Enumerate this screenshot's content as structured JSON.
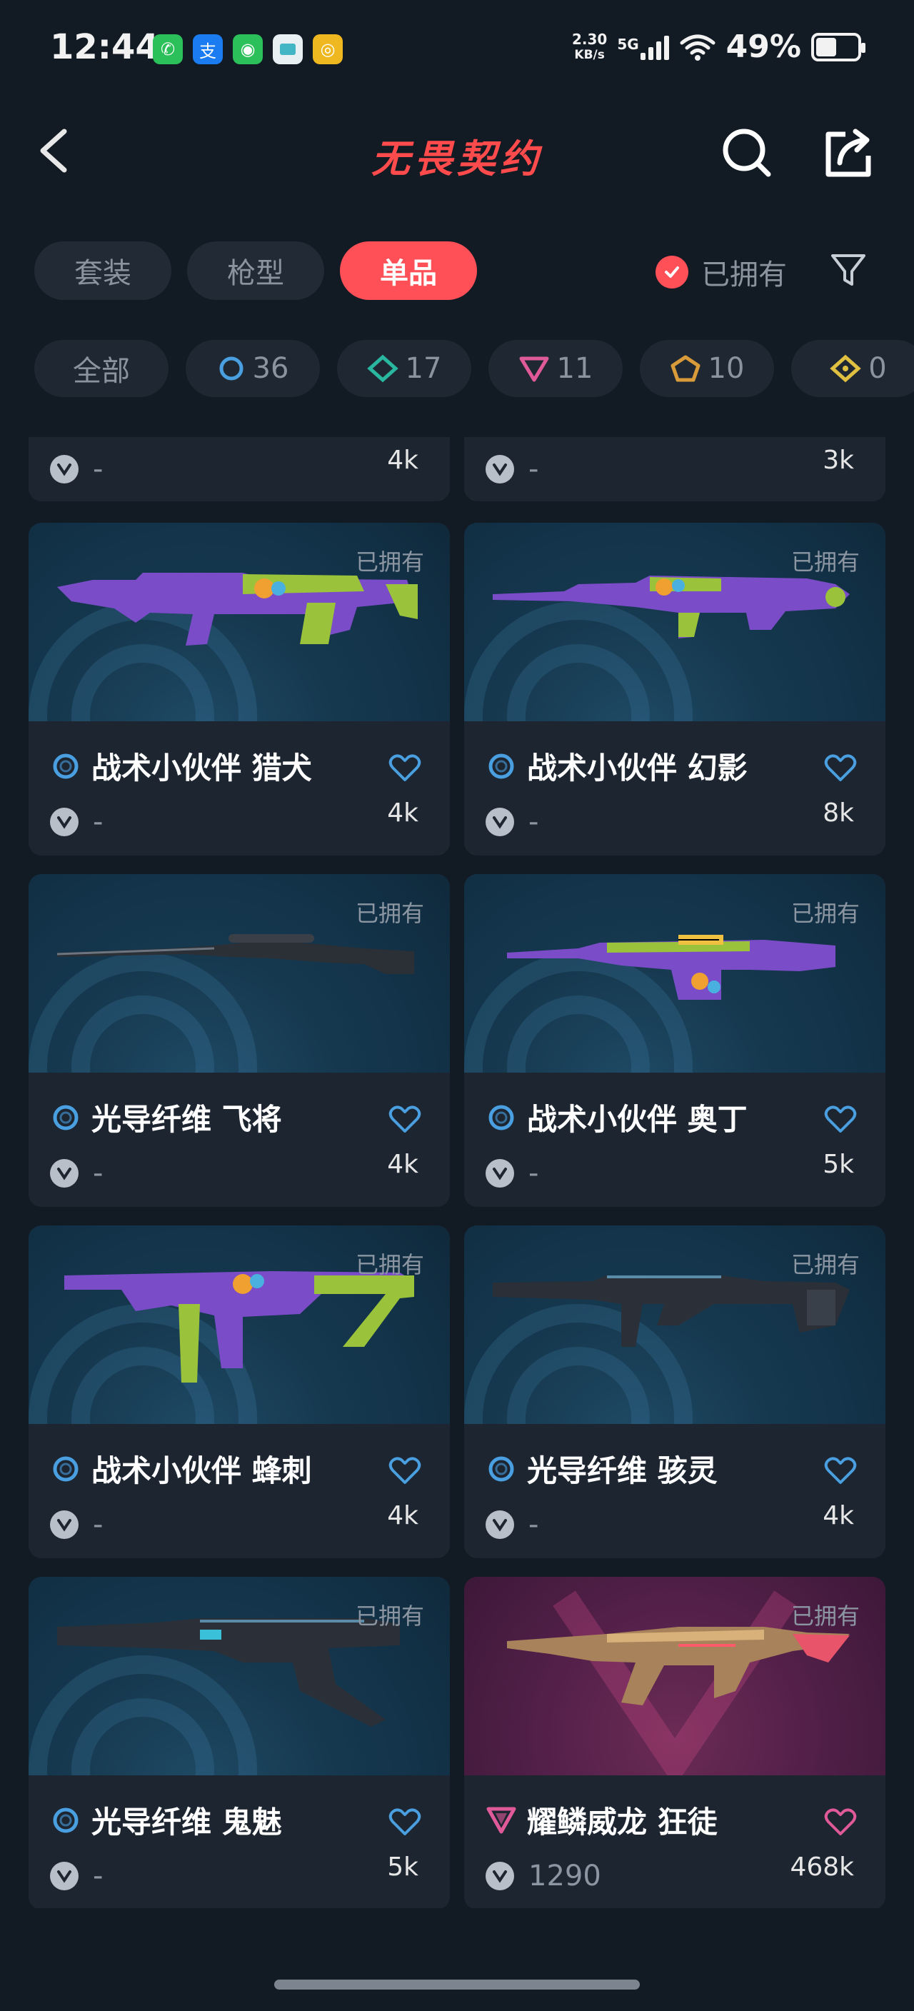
{
  "status_bar": {
    "time": "12:44",
    "net_speed_value": "2.30",
    "net_speed_unit": "KB/s",
    "net_type": "5G",
    "battery": "49%"
  },
  "header": {
    "title": "无畏契约"
  },
  "tabs": [
    "套装",
    "枪型",
    "单品"
  ],
  "active_tab": 2,
  "owned_filter_label": "已拥有",
  "tier_chips": [
    {
      "label": "全部",
      "color": ""
    },
    {
      "label": "36",
      "color": "#4a9fe0"
    },
    {
      "label": "17",
      "color": "#2ab7a0"
    },
    {
      "label": "11",
      "color": "#e05a9a"
    },
    {
      "label": "10",
      "color": "#d99a3a"
    },
    {
      "label": "0",
      "color": "#e0c040"
    }
  ],
  "partial_cards": [
    {
      "price": "-",
      "likes": "4k"
    },
    {
      "price": "-",
      "likes": "3k"
    }
  ],
  "cards": [
    {
      "name": "战术小伙伴 猎犬",
      "owned": "已拥有",
      "price": "-",
      "likes": "4k",
      "tier_color": "#4a9fe0",
      "heart_color": "#4a9fe0",
      "theme": "blue",
      "weapon": "rifle-purple"
    },
    {
      "name": "战术小伙伴 幻影",
      "owned": "已拥有",
      "price": "-",
      "likes": "8k",
      "tier_color": "#4a9fe0",
      "heart_color": "#4a9fe0",
      "theme": "blue",
      "weapon": "rifle-purple-2"
    },
    {
      "name": "光导纤维 飞将",
      "owned": "已拥有",
      "price": "-",
      "likes": "4k",
      "tier_color": "#4a9fe0",
      "heart_color": "#4a9fe0",
      "theme": "blue",
      "weapon": "sniper-black"
    },
    {
      "name": "战术小伙伴 奥丁",
      "owned": "已拥有",
      "price": "-",
      "likes": "5k",
      "tier_color": "#4a9fe0",
      "heart_color": "#4a9fe0",
      "theme": "blue",
      "weapon": "mg-purple"
    },
    {
      "name": "战术小伙伴 蜂刺",
      "owned": "已拥有",
      "price": "-",
      "likes": "4k",
      "tier_color": "#4a9fe0",
      "heart_color": "#4a9fe0",
      "theme": "blue",
      "weapon": "smg-purple"
    },
    {
      "name": "光导纤维 骇灵",
      "owned": "已拥有",
      "price": "-",
      "likes": "4k",
      "tier_color": "#4a9fe0",
      "heart_color": "#4a9fe0",
      "theme": "blue",
      "weapon": "smg-black"
    },
    {
      "name": "光导纤维 鬼魅",
      "owned": "已拥有",
      "price": "-",
      "likes": "5k",
      "tier_color": "#4a9fe0",
      "heart_color": "#4a9fe0",
      "theme": "blue",
      "weapon": "pistol-black"
    },
    {
      "name": "耀鳞威龙 狂徒",
      "owned": "已拥有",
      "price": "1290",
      "likes": "468k",
      "tier_color": "#e05a9a",
      "heart_color": "#e05a9a",
      "theme": "pink",
      "weapon": "rifle-gold"
    }
  ]
}
